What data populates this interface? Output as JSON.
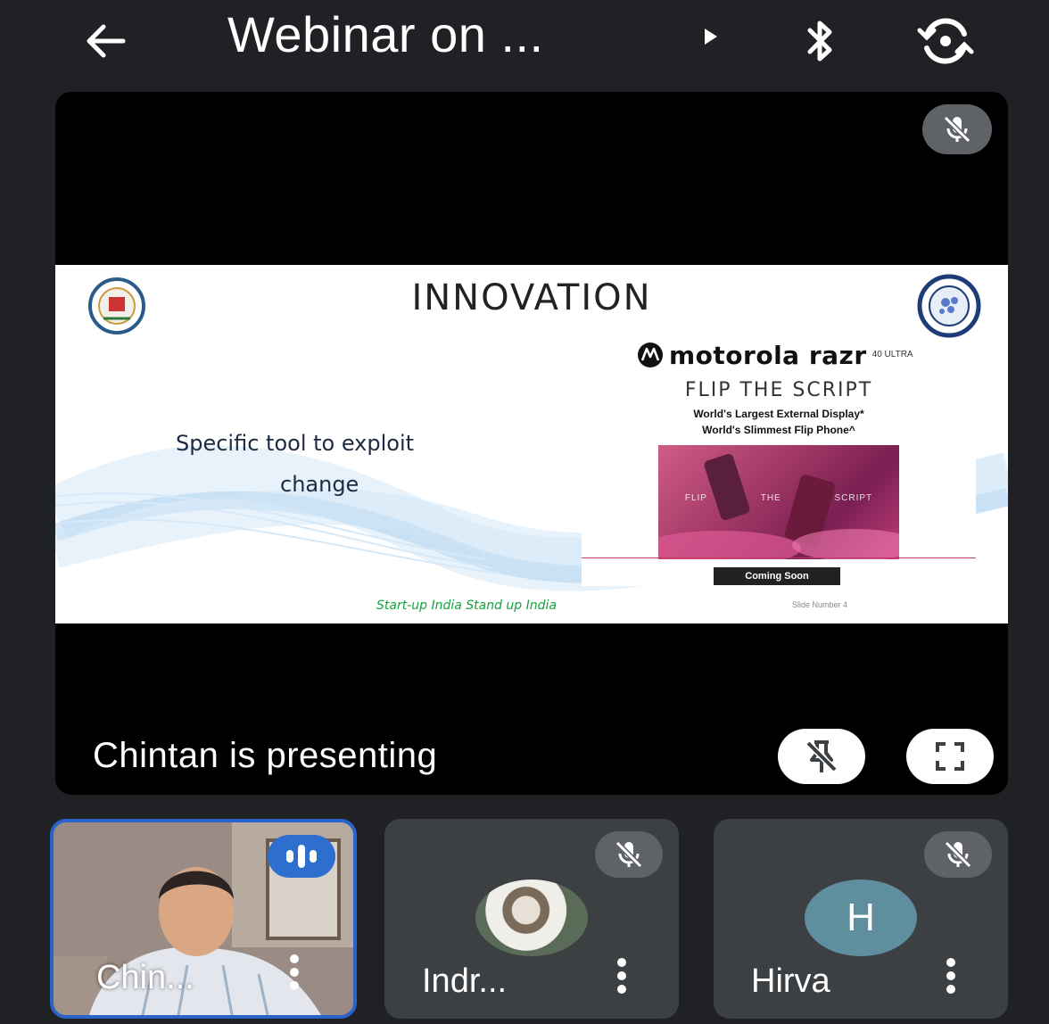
{
  "header": {
    "title": "Webinar on ...",
    "icons": [
      "back-arrow-icon",
      "caret-right-icon",
      "bluetooth-icon",
      "switch-camera-icon"
    ]
  },
  "stage": {
    "status": "Chintan is presenting",
    "slide": {
      "title": "INNOVATION",
      "body_line1": "Specific tool to exploit",
      "body_line2": "change",
      "footer": "Start-up India Stand up India",
      "slide_number": "Slide Number 4",
      "ad": {
        "brand": "motorola razr",
        "model": "40 ULTRA",
        "tagline": "FLIP THE SCRIPT",
        "line1": "World's Largest External Display*",
        "line2": "World's Slimmest Flip Phone^",
        "photo_words": [
          "FLIP",
          "THE",
          "SCRIPT"
        ],
        "cta": "Coming Soon"
      }
    }
  },
  "participants": [
    {
      "name": "Chin...",
      "state": "speaking",
      "media": "camera"
    },
    {
      "name": "Indr...",
      "state": "muted",
      "media": "profile-photo"
    },
    {
      "name": "Hirva",
      "state": "muted",
      "media": "initial",
      "initial": "H"
    }
  ],
  "colors": {
    "background": "#202124",
    "tile": "#3c4043",
    "accent": "#2d6ecf",
    "active_border": "#2a63c9"
  }
}
